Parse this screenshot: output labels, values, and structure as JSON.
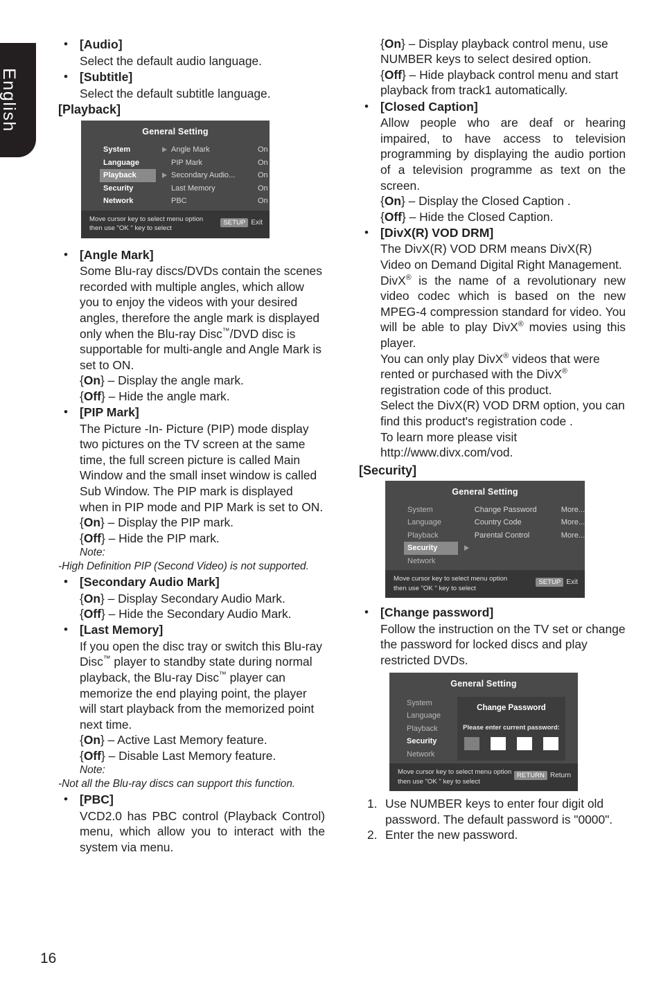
{
  "page": {
    "language_tab": "English",
    "page_number": "16"
  },
  "left_column": {
    "audio": {
      "head": "[Audio]",
      "body": "Select the default audio language."
    },
    "subtitle": {
      "head": "[Subtitle]",
      "body": "Select the default subtitle language."
    },
    "playback_section_head": "[Playback]",
    "angle_mark": {
      "head": "[Angle Mark]",
      "body_1": "Some Blu-ray discs/DVDs contain the scenes recorded with multiple angles, which allow you to enjoy the videos with your desired angles, therefore the angle mark is displayed only when the Blu-ray Disc",
      "body_2": "/DVD disc is supportable for multi-angle and Angle Mark is set to ON.",
      "on": "– Display the angle mark.",
      "off": "– Hide the angle mark."
    },
    "pip_mark": {
      "head": "[PIP Mark]",
      "body": "The Picture -In- Picture (PIP) mode display two pictures on the TV screen at the same time, the full screen picture is called Main Window and the small inset window is called Sub Window. The PIP mark is displayed when in PIP mode and PIP Mark is set to ON.",
      "on": "– Display the PIP mark.",
      "off": "– Hide the PIP mark.",
      "note_label": "Note:",
      "note_text": "-High Definition PIP (Second Video) is not supported."
    },
    "secondary_audio_mark": {
      "head": "[Secondary Audio Mark]",
      "on": "– Display Secondary Audio Mark.",
      "off": "– Hide the Secondary Audio Mark."
    },
    "last_memory": {
      "head": "[Last Memory]",
      "body_1": "If you open the disc tray or switch this Blu-ray Disc",
      "body_2": " player to standby state during normal playback, the Blu-ray Disc",
      "body_3": " player can memorize the end playing point, the player will start playback from the memorized point next time.",
      "on": "– Active Last Memory feature.",
      "off": "– Disable Last Memory feature.",
      "note_label": "Note:",
      "note_text": "-Not all the Blu-ray discs can support this function."
    },
    "pbc": {
      "head": "[PBC]",
      "body": "VCD2.0 has PBC control (Playback Control) menu, which allow you to interact with the system via menu."
    }
  },
  "right_column": {
    "pbc_options": {
      "on": "– Display playback control menu, use NUMBER keys to select desired option.",
      "off": "– Hide playback control menu and start playback from track1 automatically."
    },
    "closed_caption": {
      "head": "[Closed Caption]",
      "body": "Allow people who are deaf or hearing impaired, to have access to television programming by displaying the audio portion of a television programme as text on the screen.",
      "on": "– Display the Closed Caption .",
      "off": "– Hide the Closed Caption."
    },
    "divx": {
      "head": "[DivX(R) VOD DRM]",
      "p1": "The DivX(R) VOD DRM means DivX(R) Video on Demand Digital Right Management.",
      "p2_a": "DivX",
      "p2_b": " is the name of a revolutionary new video codec which is based on the new MPEG-4 compression standard for video. You will be able to play DivX",
      "p2_c": " movies using this player.",
      "p3_a": "You can only play DivX",
      "p3_b": " videos that were rented or purchased with the DivX",
      "p3_c": " registration code of this product.",
      "p4": "Select the DivX(R) VOD DRM option, you can find this product's registration code .",
      "p5": "To learn more please visit",
      "p6": "http://www.divx.com/vod."
    },
    "security_section_head": "[Security]",
    "change_password": {
      "head": "[Change password]",
      "body": "Follow the instruction on the TV set or change the password for locked discs and play restricted DVDs.",
      "steps": [
        "Use NUMBER keys to enter four digit old password. The default password is \"0000\".",
        "Enter the new password."
      ],
      "step_numbers": [
        "1.",
        "2."
      ]
    }
  },
  "osd_playback": {
    "title": "General Setting",
    "menu": [
      {
        "label": "System",
        "selected": false,
        "dim": false
      },
      {
        "label": "Language",
        "selected": false,
        "dim": false
      },
      {
        "label": "Playback",
        "selected": true,
        "dim": false
      },
      {
        "label": "Security",
        "selected": false,
        "dim": false
      },
      {
        "label": "Network",
        "selected": false,
        "dim": false
      }
    ],
    "items": [
      {
        "label": "Angle Mark",
        "value": "On"
      },
      {
        "label": "PIP Mark",
        "value": "On"
      },
      {
        "label": "Secondary Audio...",
        "value": "On"
      },
      {
        "label": "Last Memory",
        "value": "On"
      },
      {
        "label": "PBC",
        "value": "On"
      }
    ],
    "footer_line1": "Move cursor key to select menu option",
    "footer_line2": "then use \"OK \" key to select",
    "key_label": "SETUP",
    "key_action": "Exit"
  },
  "osd_security": {
    "title": "General Setting",
    "menu": [
      {
        "label": "System",
        "selected": false,
        "dim": true
      },
      {
        "label": "Language",
        "selected": false,
        "dim": true
      },
      {
        "label": "Playback",
        "selected": false,
        "dim": true
      },
      {
        "label": "Security",
        "selected": true,
        "dim": false
      },
      {
        "label": "Network",
        "selected": false,
        "dim": true
      }
    ],
    "items": [
      {
        "label": "Change Password",
        "value": "More..."
      },
      {
        "label": "Country Code",
        "value": "More..."
      },
      {
        "label": "Parental Control",
        "value": "More..."
      }
    ],
    "footer_line1": "Move cursor key to select menu option",
    "footer_line2": "then use \"OK \" key to select",
    "key_label": "SETUP",
    "key_action": "Exit"
  },
  "osd_change_password": {
    "title": "General Setting",
    "menu": [
      {
        "label": "System",
        "selected": false,
        "dim": true
      },
      {
        "label": "Language",
        "selected": false,
        "dim": true
      },
      {
        "label": "Playback",
        "selected": false,
        "dim": true
      },
      {
        "label": "Security",
        "selected": true,
        "dim": false
      },
      {
        "label": "Network",
        "selected": false,
        "dim": true
      }
    ],
    "dialog_title": "Change Password",
    "dialog_prompt": "Please enter current password:",
    "digit_count": 4,
    "focused_digit_index": 0,
    "footer_line1": "Move cursor key to select menu option",
    "footer_line2": "then use \"OK \" key to select",
    "key_label": "RETURN",
    "key_action": "Return"
  },
  "symbols": {
    "bullet": "•",
    "brace_open": "{",
    "brace_close": "}",
    "on": "On",
    "off": "Off",
    "registered": "®",
    "trademark": "™"
  }
}
